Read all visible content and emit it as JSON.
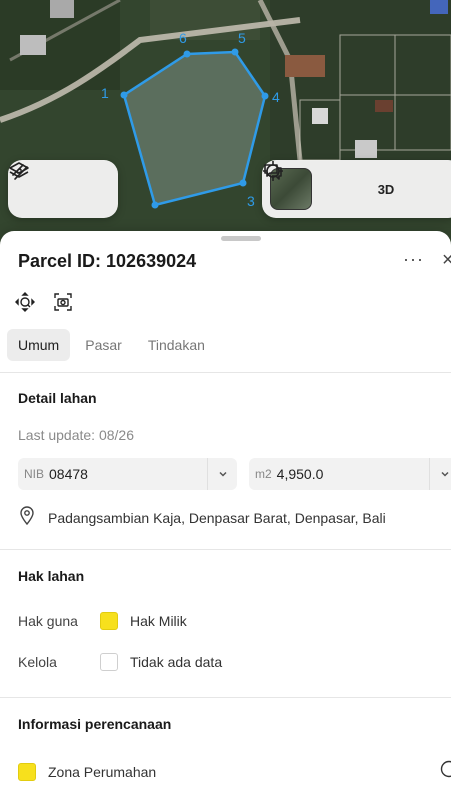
{
  "map": {
    "vertex_labels": [
      "1",
      "3",
      "4",
      "5",
      "6"
    ],
    "parcel_color": "#2f9be8",
    "toolbar_left": {
      "layers_icon": "layers-icon",
      "measure_icon": "ruler-icon"
    },
    "toolbar_right": {
      "satellite_icon": "satellite-thumbnail",
      "locate_icon": "crosshair-icon",
      "three_d_label": "3D",
      "chat_icon": "chat-icon"
    }
  },
  "sheet": {
    "title": "Parcel ID: 102639024",
    "more_label": "···",
    "close_label": "×",
    "tabs": [
      {
        "label": "Umum",
        "active": true
      },
      {
        "label": "Pasar",
        "active": false
      },
      {
        "label": "Tindakan",
        "active": false
      }
    ],
    "detail": {
      "heading": "Detail lahan",
      "last_update": "Last update: 08/26",
      "nib_label": "NIB",
      "nib_value": "08478",
      "area_label": "m2",
      "area_value": "4,950.0",
      "address": "Padangsambian Kaja, Denpasar Barat, Denpasar, Bali"
    },
    "rights": {
      "heading": "Hak lahan",
      "hak_guna_label": "Hak guna",
      "hak_guna_value": "Hak Milik",
      "hak_guna_color": "#f7e01d",
      "kelola_label": "Kelola",
      "kelola_value": "Tidak ada data"
    },
    "planning": {
      "heading": "Informasi perencanaan",
      "zone_value": "Zona Perumahan",
      "zone_color": "#f7e01d"
    }
  }
}
